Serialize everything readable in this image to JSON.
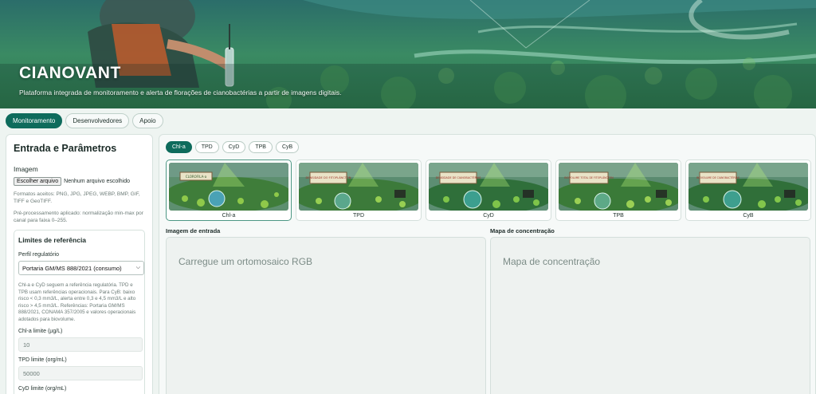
{
  "hero": {
    "title": "CIANOVANT",
    "subtitle": "Plataforma integrada de monitoramento e alerta de florações de cianobactérias a partir de imagens digitais."
  },
  "nav_tabs": [
    "Monitoramento",
    "Desenvolvedores",
    "Apoio"
  ],
  "left_panel": {
    "title": "Entrada e Parâmetros",
    "image_label": "Imagem",
    "file_button": "Escolher arquivo",
    "file_status": "Nenhum arquivo escolhido",
    "formats_hint": "Formatos aceitos: PNG, JPG, JPEG, WEBP, BMP, GIF, TIFF e GeoTIFF.",
    "preprocess_hint": "Pré-processamento aplicado: normalização min-max por canal para faixa 0–255.",
    "limits": {
      "title": "Limites de referência",
      "profile_label": "Perfil regulatório",
      "profile_value": "Portaria GM/MS 888/2021 (consumo)",
      "note": "Chl-a e CyD seguem a referência regulatória. TPD e TPB usam referências operacionais. Para CyB: baixo risco < 0,3 mm3/L, alerta entre 0,3 e 4,5 mm3/L e alto risco > 4,5 mm3/L. Referências: Portaria GM/MS 888/2021, CONAMA 357/2005 e valores operacionais adotados para biovolume.",
      "fields": [
        {
          "label": "Chl-a limite (µg/L)",
          "value": "10"
        },
        {
          "label": "TPD limite (org/mL)",
          "value": "50000"
        },
        {
          "label": "CyD limite (org/mL)",
          "value": ""
        }
      ]
    }
  },
  "metric_pills": [
    "Chl-a",
    "TPD",
    "CyD",
    "TPB",
    "CyB"
  ],
  "cards": [
    {
      "label": "Chl-a",
      "sign": "CLOROFILA-a"
    },
    {
      "label": "TPD",
      "sign": "DENSIDADE DO FITOPLÂNCTON"
    },
    {
      "label": "CyD",
      "sign": "DENSIDADE DE CIANOBACTÉRIAS"
    },
    {
      "label": "TPB",
      "sign": "BIOVOLUME TOTAL DE FITOPLÂNCTON"
    },
    {
      "label": "CyB",
      "sign": "BIOVOLUME DE CIANOBACTÉRIAS"
    }
  ],
  "input_section": {
    "title": "Imagem de entrada",
    "placeholder": "Carregue um ortomosaico RGB"
  },
  "map_section": {
    "title": "Mapa de concentração",
    "placeholder": "Mapa de concentração"
  },
  "colors": {
    "accent": "#0e6b5c",
    "background": "#eef4f1"
  }
}
